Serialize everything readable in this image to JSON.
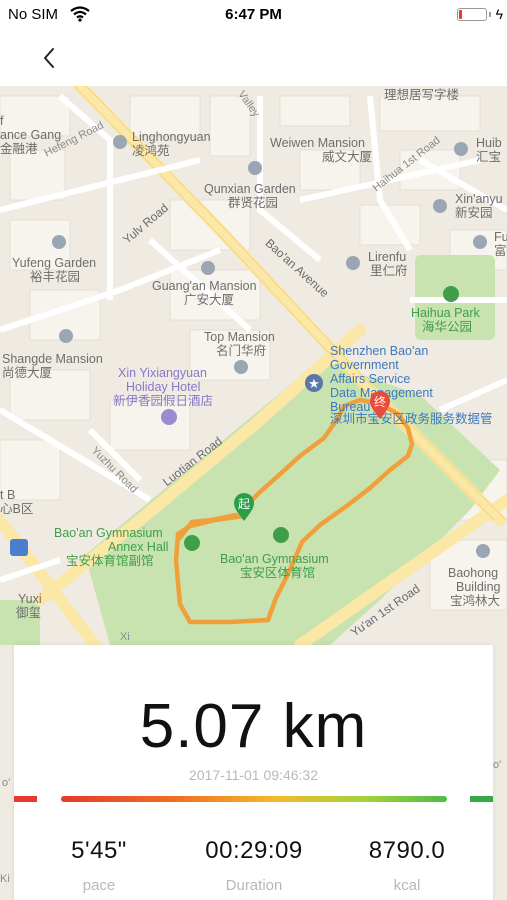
{
  "status_bar": {
    "carrier": "No SIM",
    "time": "6:47 PM",
    "battery_level": 0.1,
    "battery_color": "#e53935"
  },
  "nav": {
    "back_icon": "chevron-left-icon"
  },
  "map": {
    "labels": {
      "l1": "理想居写字楼",
      "l2": "f",
      "l3": "ance Gang",
      "l4": "金融港",
      "l5": "Linghongyuan",
      "l6": "凌鸿苑",
      "l7": "Weiwen Mansion",
      "l8": "威文大厦",
      "l9": "Huib",
      "l10": "汇宝",
      "l11": "Hefeng Road",
      "l12": "Qunxian Garden",
      "l13": "群贤花园",
      "l14": "Haihua 1st Road",
      "l15": "Xin'anyu",
      "l16": "新安园",
      "l17": "Yulv Road",
      "l18": "Bao'an Avenue",
      "l19": "Fu",
      "l20": "富",
      "l21": "Yufeng Garden",
      "l22": "裕丰花园",
      "l23": "Lirenfu",
      "l24": "里仁府",
      "l25": "Guang'an Mansion",
      "l26": "广安大厦",
      "l27": "Haihua Park",
      "l28": "海华公园",
      "l29": "Top Mansion",
      "l30": "名门华府",
      "l31": "Shangde Mansion",
      "l32": "尚德大厦",
      "l33": "Shenzhen Bao'an",
      "l34": "Government",
      "l35": "Affairs Service",
      "l36": "Data Management",
      "l37": "Bureau",
      "l38": "深圳市宝安区政务服务数据管",
      "l39": "Xin Yixiangyuan",
      "l40": "Holiday Hotel",
      "l41": "新伊香园假日酒店",
      "l42": "Yuzhu Road",
      "l43": "Luotian Road",
      "l44": "t B",
      "l45": "心B区",
      "l46": "Bao'an Gymnasium",
      "l47": "Annex Hall",
      "l48": "宝安体育馆副馆",
      "l49": "Bao'an Gymnasium",
      "l50": "宝安区体育馆",
      "l51": "Baohong",
      "l52": "Building",
      "l53": "宝鸿林大",
      "l54": "Yu'an 1st Road",
      "l55": "Yuxi",
      "l56": "御玺",
      "l57": "Valley",
      "l58": "Xi",
      "l59": "Ki",
      "l60": "o'",
      "l61": "o'"
    },
    "start_marker_label": "起",
    "end_marker_label": "终",
    "route_color": "#f0a03a",
    "park_color": "#cde6b8"
  },
  "summary": {
    "distance": "5.07 km",
    "datetime": "2017-11-01 09:46:32",
    "pace_value": "5'45\"",
    "pace_label": "pace",
    "duration_value": "00:29:09",
    "duration_label": "Duration",
    "kcal_value": "8790.0",
    "kcal_label": "kcal"
  }
}
